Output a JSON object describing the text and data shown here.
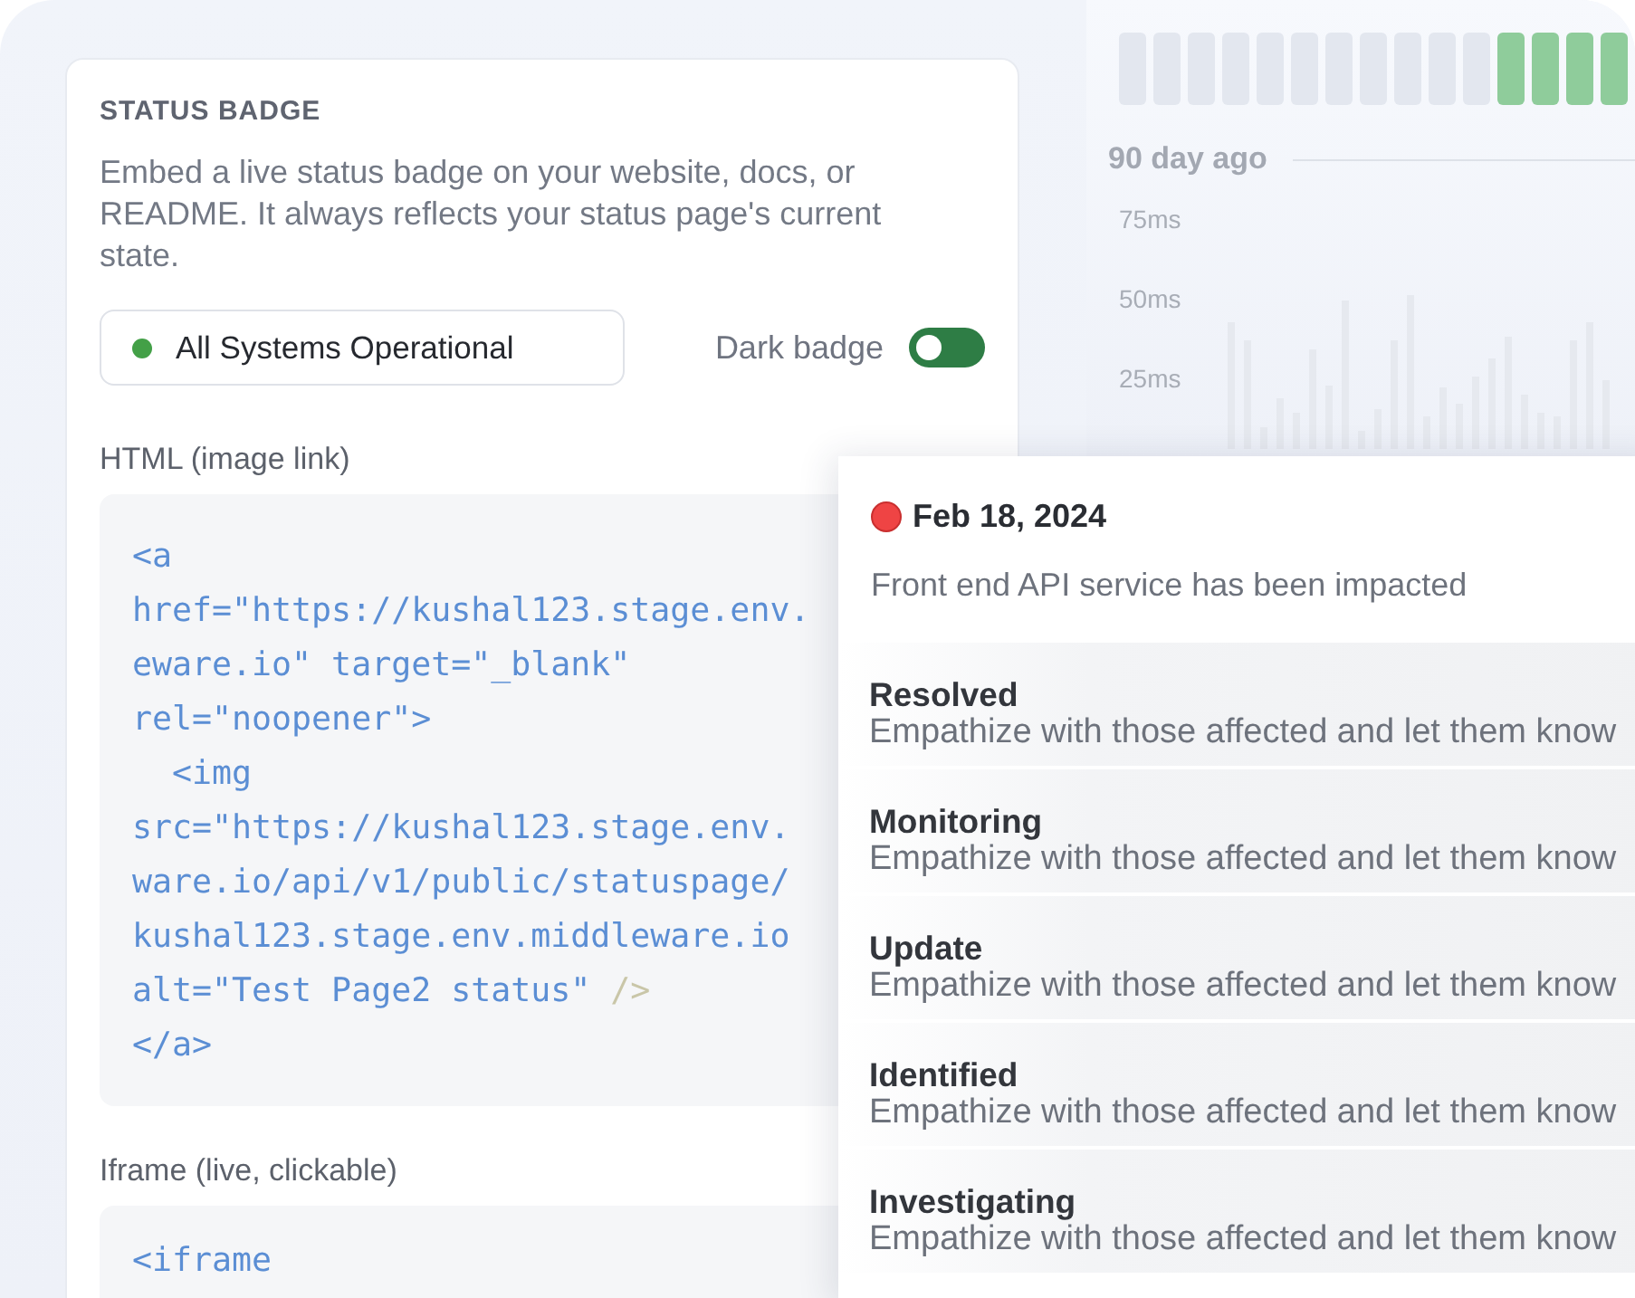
{
  "status_badge": {
    "title": "STATUS BADGE",
    "description": "Embed a live status badge on your website, docs, or README. It always reflects your status page's current state.",
    "badge": {
      "label": "All Systems Operational",
      "color": "#43a047"
    },
    "dark_badge": {
      "label": "Dark badge",
      "on": false
    },
    "snippets": [
      {
        "label": "HTML (image link)",
        "lines": [
          [
            {
              "text": "<a",
              "kind": "code"
            }
          ],
          [
            {
              "text": "href=\"https://kushal123.stage.env.",
              "kind": "code"
            }
          ],
          [
            {
              "text": "eware.io\" target=\"_blank\"",
              "kind": "code"
            }
          ],
          [
            {
              "text": "rel=\"noopener\">",
              "kind": "code"
            }
          ],
          [
            {
              "text": "  <img",
              "kind": "code"
            }
          ],
          [
            {
              "text": "src=\"https://kushal123.stage.env.",
              "kind": "code"
            }
          ],
          [
            {
              "text": "ware.io/api/v1/public/statuspage/",
              "kind": "code"
            }
          ],
          [
            {
              "text": "kushal123.stage.env.middleware.io",
              "kind": "code"
            }
          ],
          [
            {
              "text": "alt=\"Test Page2 status\" ",
              "kind": "code"
            },
            {
              "text": "/>",
              "kind": "muted"
            }
          ],
          [
            {
              "text": "</a>",
              "kind": "code"
            }
          ]
        ]
      },
      {
        "label": "Iframe (live, clickable)",
        "lines": [
          [
            {
              "text": "<iframe",
              "kind": "code"
            }
          ]
        ]
      }
    ]
  },
  "uptime": {
    "days": [
      {
        "color": "#e3e7ef"
      },
      {
        "color": "#e3e7ef"
      },
      {
        "color": "#e3e7ef"
      },
      {
        "color": "#e3e7ef"
      },
      {
        "color": "#e3e7ef"
      },
      {
        "color": "#e3e7ef"
      },
      {
        "color": "#e3e7ef"
      },
      {
        "color": "#e3e7ef"
      },
      {
        "color": "#e3e7ef"
      },
      {
        "color": "#e3e7ef"
      },
      {
        "color": "#e3e7ef"
      },
      {
        "color": "#8fcc9b"
      },
      {
        "color": "#8fcc9b"
      },
      {
        "color": "#8fcc9b"
      },
      {
        "color": "#8fcc9b"
      }
    ],
    "range_label": "90 day ago"
  },
  "latency": {
    "y_labels": [
      "75ms",
      "50ms",
      "25ms"
    ]
  },
  "incident": {
    "date": "Feb 18, 2024",
    "summary": "Front end API service has been impacted",
    "updates": [
      {
        "status": "Resolved",
        "message": "Empathize with those affected and let them know"
      },
      {
        "status": "Monitoring",
        "message": "Empathize with those affected and let them know"
      },
      {
        "status": "Update",
        "message": "Empathize with those affected and let them know"
      },
      {
        "status": "Identified",
        "message": "Empathize with those affected and let them know"
      },
      {
        "status": "Investigating",
        "message": "Empathize with those affected and let them know"
      }
    ]
  }
}
